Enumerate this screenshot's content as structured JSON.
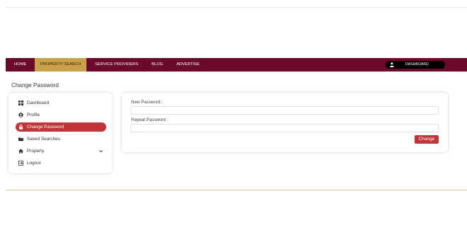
{
  "nav": {
    "items": [
      {
        "label": "HOME"
      },
      {
        "label": "PROPERTY SEARCH"
      },
      {
        "label": "SERVICE PROVIDERS"
      },
      {
        "label": "BLOG"
      },
      {
        "label": "ADVERTISE"
      }
    ],
    "dashboard_label": "DASHBOARD"
  },
  "page": {
    "title": "Change Password"
  },
  "sidebar": {
    "items": [
      {
        "label": "Dashboard",
        "icon": "grid-icon"
      },
      {
        "label": "Profile",
        "icon": "user-circle-icon"
      },
      {
        "label": "Change Password",
        "icon": "lock-icon"
      },
      {
        "label": "Saved Searches",
        "icon": "folder-icon"
      },
      {
        "label": "Property",
        "icon": "home-icon"
      },
      {
        "label": "Logout",
        "icon": "logout-icon"
      }
    ]
  },
  "form": {
    "new_password_label": "New Password :",
    "repeat_password_label": "Repeat Password :",
    "new_password_value": "",
    "repeat_password_value": "",
    "submit_label": "Change"
  },
  "colors": {
    "navbar": "#6b0a2a",
    "nav_active": "#c7a24a",
    "accent_red": "#c0343a"
  }
}
